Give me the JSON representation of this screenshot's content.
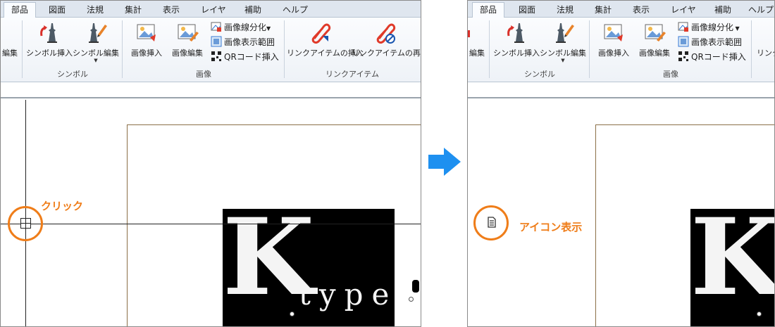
{
  "tabs": [
    "部品",
    "図面",
    "法規",
    "集計",
    "表示",
    "レイヤ",
    "補助",
    "ヘルプ"
  ],
  "tabs_after_last": "ヘルプ",
  "ribbon": {
    "partial_edit_label": "編集",
    "partial_link_label": "リンク",
    "symbol_insert": "シンボル挿入",
    "symbol_edit": "シンボル編集",
    "symbol_group": "シンボル",
    "image_insert": "画像挿入",
    "image_edit": "画像編集",
    "image_line_split": "画像線分化",
    "image_display_range": "画像表示範囲",
    "qr_insert": "QRコード挿入",
    "image_group": "画像",
    "link_insert": "リンクアイテムの挿入",
    "link_play": "リンクアイテムの再生",
    "link_group": "リンクアイテム"
  },
  "annotation_before": "クリック",
  "annotation_after": "アイコン表示",
  "image_text": {
    "big_letter": "K",
    "word": "type"
  },
  "colors": {
    "accent_orange": "#ef7d19",
    "arrow_blue": "#1e90f0",
    "tabbar": "#dfe6ef",
    "link_red": "#e03a2a"
  },
  "icons": {
    "arrow": "right-arrow-icon",
    "note": "note-icon",
    "crosshair": "crosshair-box-icon"
  }
}
